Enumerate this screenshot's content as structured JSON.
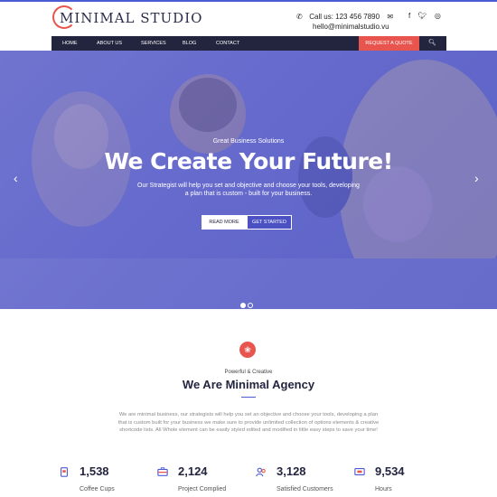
{
  "brand": {
    "name": "MINIMAL STUDIO",
    "accent": "#e8554e",
    "primary": "#4b5bd6",
    "dark": "#23253f"
  },
  "contact": {
    "phone": "Call us: 123 456 7890",
    "email": "hello@minimalstudio.vu"
  },
  "social": [
    "facebook-icon",
    "twitter-icon",
    "instagram-icon"
  ],
  "nav": {
    "items": [
      "HOME",
      "ABOUT US",
      "SERVICES",
      "BLOG",
      "CONTACT"
    ],
    "quote": "REQUEST A QUOTE"
  },
  "hero": {
    "kicker": "Great Business Solutions",
    "headline": "We Create Your Future!",
    "subtext": "Our Strategist will help you set and objective and choose your tools, developing a plan that is custom - built for your business.",
    "button_read": "READ MORE",
    "button_start": "GET STARTED"
  },
  "about": {
    "kicker": "Powerful & Creative",
    "title": "We Are Minimal Agency",
    "text": "We are minimal business, our strategists will help you set an objective and choose your tools, developing a plan that is custom built for your business we make sure to provide unlimited collection of options elements & creative shortcode lists. All Whole element can be easily styled edited and modified in little easy steps to save your time!"
  },
  "stats": [
    {
      "value": "1,538",
      "label": "Coffee Cups",
      "icon": "coffee-cup-icon"
    },
    {
      "value": "2,124",
      "label": "Project Complied",
      "icon": "briefcase-icon"
    },
    {
      "value": "3,128",
      "label": "Satisfied Customers",
      "icon": "customers-icon"
    },
    {
      "value": "9,534",
      "label": "Hours",
      "icon": "ticket-icon"
    }
  ]
}
